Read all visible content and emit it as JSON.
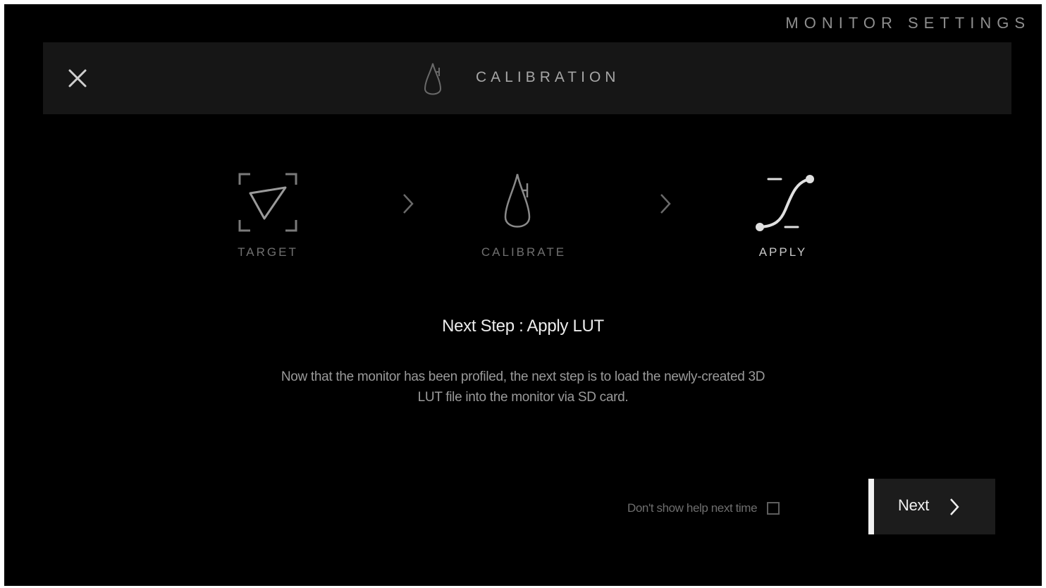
{
  "app": {
    "section_title": "MONITOR SETTINGS"
  },
  "header": {
    "title": "CALIBRATION",
    "close_icon": "close-icon",
    "title_icon": "calibration-probe-icon"
  },
  "steps": [
    {
      "label": "TARGET",
      "icon": "target-triangle-icon",
      "state": "inactive"
    },
    {
      "label": "CALIBRATE",
      "icon": "calibration-probe-icon",
      "state": "inactive"
    },
    {
      "label": "APPLY",
      "icon": "lut-curve-icon",
      "state": "active"
    }
  ],
  "content": {
    "headline": "Next Step : Apply LUT",
    "description": "Now that the monitor has been profiled, the next step is to load the newly-created 3D LUT file into the monitor via SD card."
  },
  "footer": {
    "help_checkbox_label": "Don't show help next time",
    "help_checkbox_checked": false,
    "next_label": "Next",
    "next_icon": "chevron-right-icon"
  },
  "colors": {
    "background": "#000000",
    "header_bar": "#161616",
    "button": "#1c1c1c",
    "accent": "#f2f2f2"
  }
}
